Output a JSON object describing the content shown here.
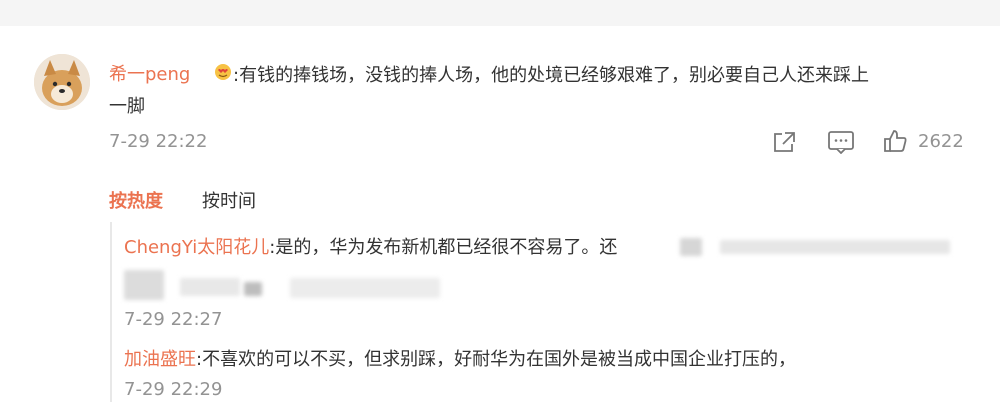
{
  "comment": {
    "username": "希一peng",
    "emoji_icon": "face-hearts-emoji-icon",
    "text_line1": ":有钱的捧钱场，没钱的捧人场，他的处境已经够艰难了，别必要自己人还来踩上",
    "text_line2": "一脚",
    "time": "7-29 22:22",
    "actions": {
      "share_icon": "share-icon",
      "reply_icon": "comment-icon",
      "like_icon": "thumbs-up-icon",
      "like_count": "2622"
    }
  },
  "sort": {
    "hot_label": "按热度",
    "time_label": "按时间"
  },
  "replies": [
    {
      "username": "ChengYi太阳花儿",
      "text": ":是的，华为发布新机都已经很不容易了。还",
      "time": "7-29 22:27"
    },
    {
      "username": "加油盛旺",
      "text": ":不喜欢的可以不买，但求别踩，好耐华为在国外是被当成中国企业打压的，",
      "time": "7-29 22:29"
    }
  ],
  "colors": {
    "accent": "#eb7350",
    "muted": "#939393",
    "text": "#333333"
  }
}
